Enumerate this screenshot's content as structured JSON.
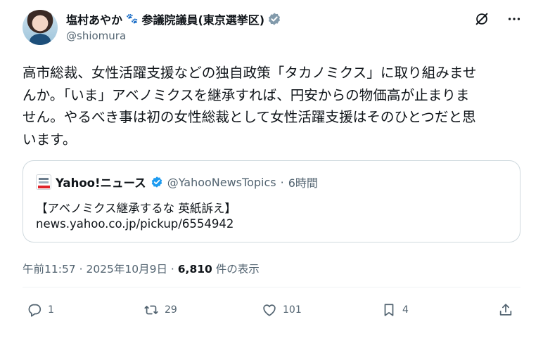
{
  "author": {
    "display_name": "塩村あやか",
    "display_name_suffix": "参議院議員(東京選挙区)",
    "handle": "@shiomura"
  },
  "tweet": {
    "text_lines": [
      "高市総裁、女性活躍支援などの独自政策「タカノミクス」に取り組みませ",
      "んか。「いま」アベノミクスを継承すれば、円安からの物価高が止まりま",
      "せん。やるべき事は初の女性総裁として女性活躍支援はそのひとつだと思",
      "います。"
    ]
  },
  "quote": {
    "name": "Yahoo!ニュース",
    "handle": "@YahooNewsTopics",
    "separator": "·",
    "time": "6時間",
    "title": "【アベノミクス継承するな 英紙訴え】",
    "link": "news.yahoo.co.jp/pickup/6554942"
  },
  "meta": {
    "time": "午前11:57",
    "sep1": " · ",
    "date": "2025年10月9日",
    "sep2": " · ",
    "views": "6,810",
    "views_label": " 件の表示"
  },
  "actions": {
    "replies": "1",
    "reposts": "29",
    "likes": "101",
    "bookmarks": "4"
  },
  "icons": {
    "verified": "verified-badge-icon",
    "grok": "grok-icon",
    "more": "more-icon",
    "reply": "reply-icon",
    "repost": "repost-icon",
    "like": "heart-icon",
    "bookmark": "bookmark-icon",
    "share": "share-icon"
  },
  "colors": {
    "verified_blue": "#1d9bf0",
    "text": "#0f1419",
    "secondary": "#536471",
    "border": "#cfd9de"
  }
}
